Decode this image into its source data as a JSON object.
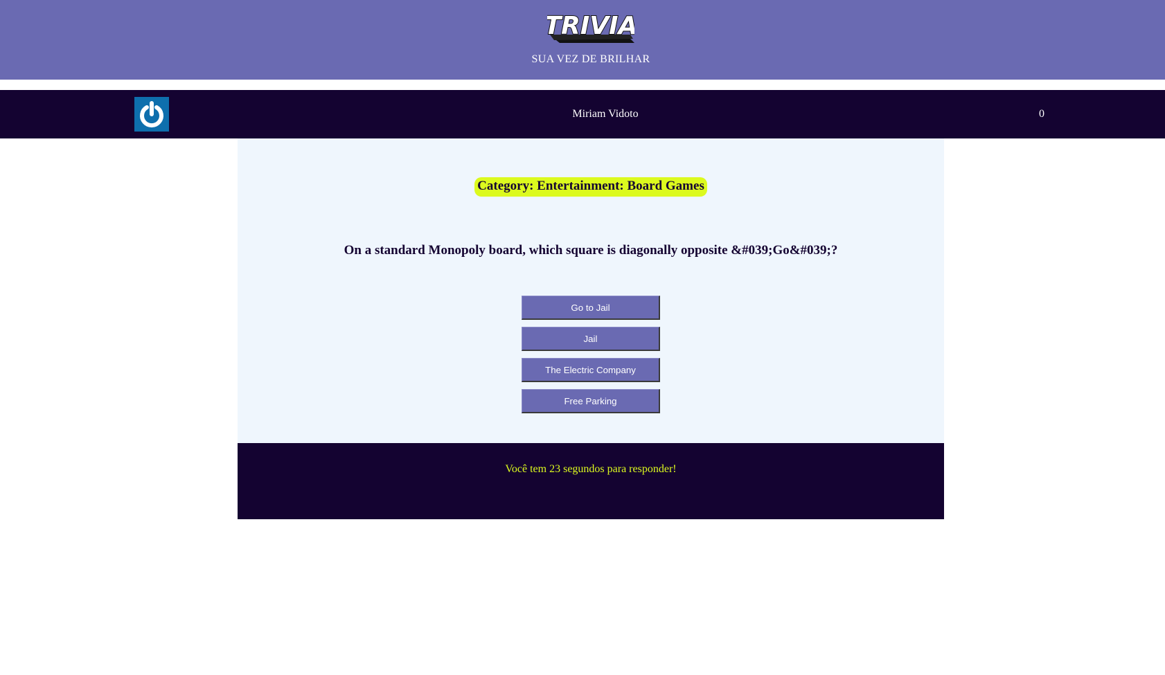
{
  "header": {
    "logo_text": "TRIVIA",
    "tagline": "SUA VEZ DE BRILHAR",
    "background_color": "#6a6ab2"
  },
  "player_bar": {
    "logout_icon": "power-icon",
    "player_name": "Miriam Vidoto",
    "score": "0",
    "background_color": "#140331",
    "button_color": "#0e6fad"
  },
  "game": {
    "category": "Category: Entertainment: Board Games",
    "question": "On a standard Monopoly board, which square is diagonally opposite &#039;Go&#039;?",
    "answers": [
      {
        "label": "Go to Jail"
      },
      {
        "label": "Jail"
      },
      {
        "label": "The Electric Company"
      },
      {
        "label": "Free Parking"
      }
    ],
    "category_badge_color": "#dcfa1e",
    "answer_button_color": "#6a6ab2"
  },
  "timer": {
    "text": "Você tem 23 segundos para responder!",
    "text_color": "#dcfa1e"
  }
}
